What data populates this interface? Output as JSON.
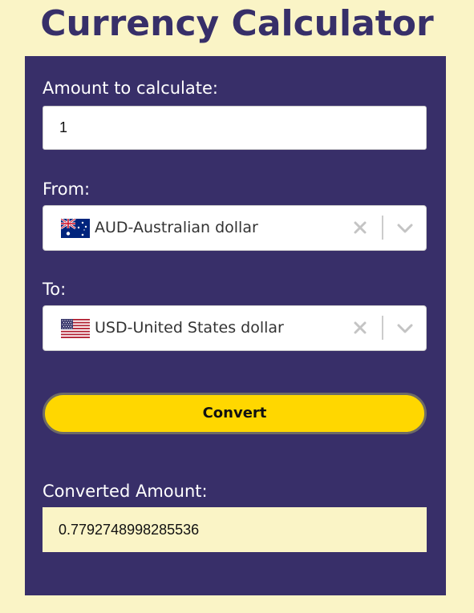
{
  "page": {
    "title": "Currency Calculator",
    "background_color": "#faf4c6",
    "panel_color": "#382f69",
    "accent_color": "#ffd700"
  },
  "amount": {
    "label": "Amount to calculate:",
    "value": "1"
  },
  "from": {
    "label": "From:",
    "selected": "AUD-Australian dollar",
    "flag_icon": "australia-flag-icon"
  },
  "to": {
    "label": "To:",
    "selected": "USD-United States dollar",
    "flag_icon": "usa-flag-icon"
  },
  "convert": {
    "label": "Convert"
  },
  "result": {
    "label": "Converted Amount:",
    "value": "0.7792748998285536"
  }
}
